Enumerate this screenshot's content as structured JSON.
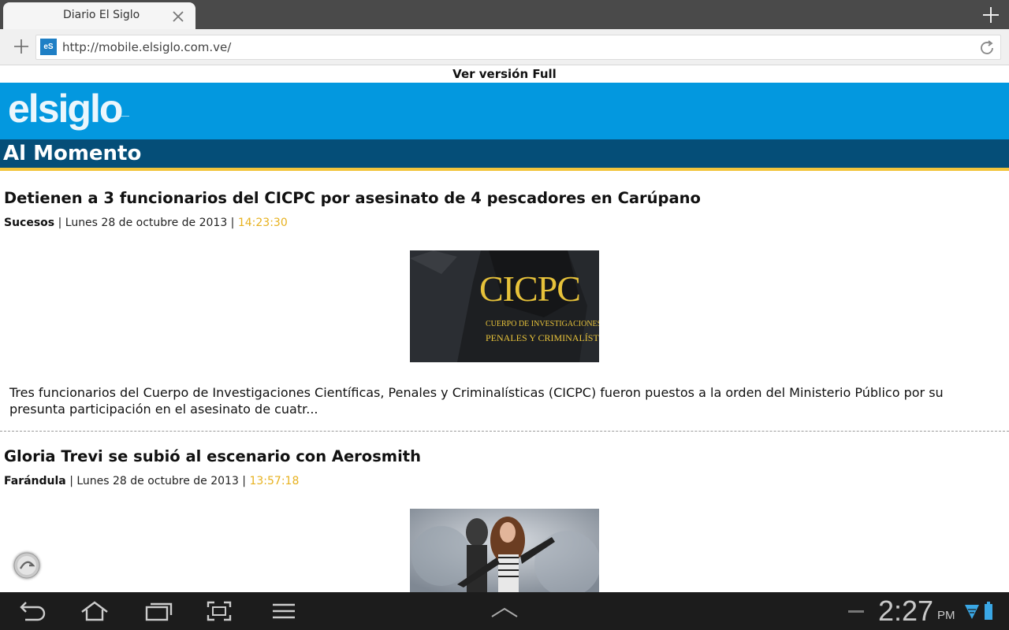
{
  "browser": {
    "tab_title": "Diario El Siglo",
    "url": "http://mobile.elsiglo.com.ve/",
    "favicon_text": "eS"
  },
  "page": {
    "full_version_link": "Ver versión Full",
    "logo_text": "elsiglo",
    "section_title": "Al Momento",
    "articles": [
      {
        "title": "Detienen a 3 funcionarios del CICPC por asesinato de 4 pescadores en Carúpano",
        "category": "Sucesos",
        "date": "| Lunes 28 de octubre de 2013 |",
        "time": "14:23:30",
        "image_text_1": "CICPC",
        "image_text_2": "CUERPO DE INVESTIGACIONES CIENTÍFICAS",
        "image_text_3": "PENALES Y CRIMINALÍSTICAS",
        "summary": "Tres funcionarios del Cuerpo de Investigaciones Científicas, Penales y Criminalísticas (CICPC) fueron puestos a la orden del Ministerio Público por su presunta participación en el asesinato de cuatr..."
      },
      {
        "title": "Gloria Trevi se subió al escenario con Aerosmith",
        "category": "Farándula",
        "date": "| Lunes 28 de octubre de 2013 |",
        "time": "13:57:18"
      }
    ]
  },
  "system": {
    "time": "2:27",
    "ampm": "PM"
  },
  "colors": {
    "brand_blue": "#0398df",
    "section_navy": "#054e78",
    "accent_yellow": "#f2c53d",
    "time_color": "#e7b11e"
  },
  "icons": [
    "close-icon",
    "plus-icon",
    "reload-icon",
    "back-icon",
    "home-icon",
    "recent-apps-icon",
    "screenshot-icon",
    "menu-icon",
    "chevron-up-icon",
    "wifi-icon",
    "battery-icon",
    "scroll-top-icon"
  ]
}
